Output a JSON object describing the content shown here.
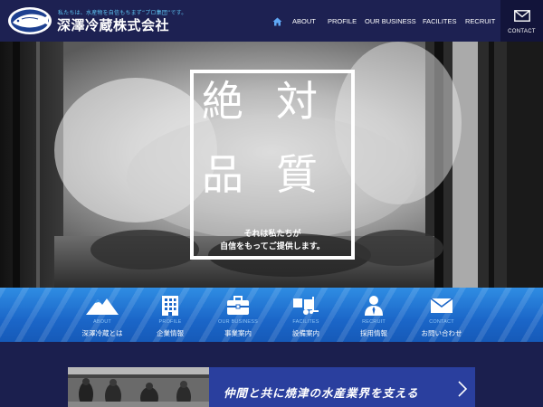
{
  "header": {
    "tagline": "私たちは、水産物を自信もちまず“プロ集団”です。",
    "company_name": "深澤冷蔵株式会社",
    "logo_icon": "fish-emblem-logo",
    "nav": {
      "home_icon": "home-icon",
      "items": [
        "ABOUT",
        "PROFILE",
        "OUR BUSINESS",
        "FACILITES",
        "RECRUIT"
      ]
    },
    "contact": {
      "icon": "mail-icon",
      "label": "CONTACT"
    }
  },
  "hero": {
    "headline_chars": [
      "絶",
      "対",
      "品",
      "質"
    ],
    "sub_line1": "それは私たちが",
    "sub_line2": "自信をもってご提供します。"
  },
  "categories": [
    {
      "icon": "mountain-icon",
      "en": "ABOUT",
      "jp": "深澤冷蔵とは"
    },
    {
      "icon": "building-icon",
      "en": "PROFILE",
      "jp": "企業情報"
    },
    {
      "icon": "briefcase-icon",
      "en": "OUR BUSINESS",
      "jp": "事業案内"
    },
    {
      "icon": "forklift-icon",
      "en": "FACILITES",
      "jp": "設備案内"
    },
    {
      "icon": "person-icon",
      "en": "RECRUIT",
      "jp": "採用情報"
    },
    {
      "icon": "envelope-icon",
      "en": "CONTACT",
      "jp": "お問い合わせ"
    }
  ],
  "banner": {
    "text": "仲間と共に焼津の水産業界を支える",
    "arrow_icon": "chevron-right-icon"
  },
  "colors": {
    "header_bg": "#1d2152",
    "accent_blue": "#1b66c8",
    "tagline_cyan": "#5fc7f5",
    "banner_bg": "#2a3f9e"
  }
}
